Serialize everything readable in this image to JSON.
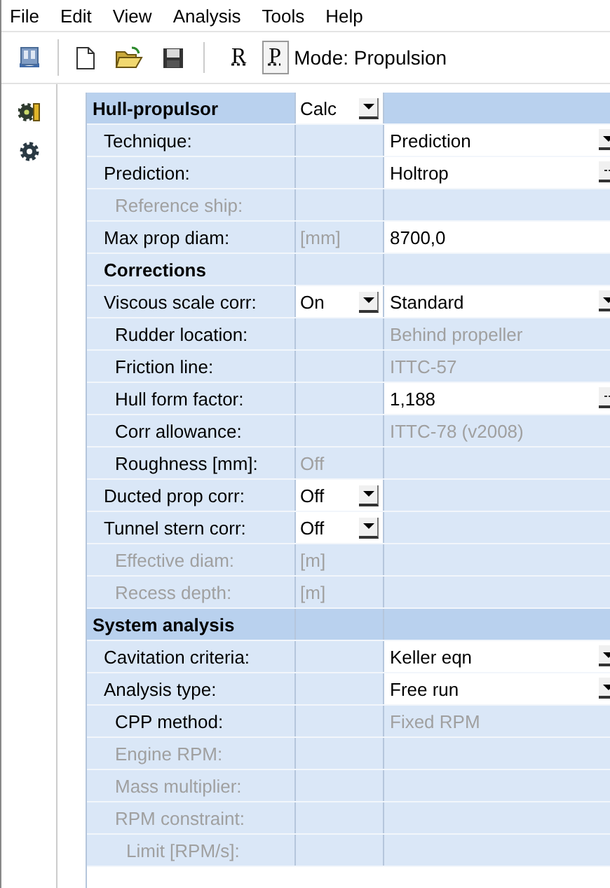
{
  "menu": [
    {
      "label": "File"
    },
    {
      "label": "Edit"
    },
    {
      "label": "View"
    },
    {
      "label": "Analysis"
    },
    {
      "label": "Tools"
    },
    {
      "label": "Help"
    }
  ],
  "toolbar": {
    "items": [
      {
        "kind": "new"
      },
      {
        "kind": "open"
      },
      {
        "kind": "save"
      },
      {
        "kind": "separator"
      },
      {
        "kind": "letter",
        "label": "R",
        "pressed": false
      },
      {
        "kind": "letter",
        "label": "P",
        "pressed": true
      }
    ],
    "mode": "Mode: Propulsion"
  },
  "side_tools": [
    {
      "kind": "gears"
    },
    {
      "kind": "gear"
    }
  ],
  "grid": {
    "rows": [
      {
        "kind": "section",
        "label": "Hull-propulsor",
        "option": {
          "value": "Calc"
        },
        "children": [
          {
            "kind": "param",
            "label": "Technique:",
            "disabled": false,
            "value": {
              "text": "Prediction",
              "disabled": false,
              "kind": "dropdown"
            }
          },
          {
            "kind": "param",
            "label": "Prediction:",
            "disabled": false,
            "value": {
              "text": "Holtrop",
              "disabled": false,
              "kind": "browse"
            },
            "children": [
              {
                "kind": "param",
                "label": "Reference ship:",
                "disabled": true
              }
            ]
          },
          {
            "kind": "param",
            "label": "Max prop diam:",
            "disabled": false,
            "unit": "[mm]",
            "value": {
              "text": "8700,0",
              "disabled": false,
              "kind": "text"
            }
          },
          {
            "kind": "heading",
            "label": "Corrections"
          },
          {
            "kind": "param",
            "label": "Viscous scale corr:",
            "disabled": false,
            "option": {
              "value": "On"
            },
            "value": {
              "text": "Standard",
              "disabled": false,
              "kind": "dropdown"
            },
            "children": [
              {
                "kind": "param",
                "label": "Rudder location:",
                "disabled": false,
                "value": {
                  "text": "Behind propeller",
                  "disabled": true
                }
              },
              {
                "kind": "param",
                "label": "Friction line:",
                "disabled": false,
                "value": {
                  "text": "ITTC-57",
                  "disabled": true
                }
              },
              {
                "kind": "param",
                "label": "Hull form factor:",
                "disabled": false,
                "value": {
                  "text": "1,188",
                  "disabled": false,
                  "kind": "browse"
                }
              },
              {
                "kind": "param",
                "label": "Corr allowance:",
                "disabled": false,
                "value": {
                  "text": "ITTC-78 (v2008)",
                  "disabled": true
                }
              },
              {
                "kind": "param",
                "label": "Roughness [mm]:",
                "disabled": false,
                "unit": "Off"
              }
            ]
          },
          {
            "kind": "param",
            "label": "Ducted prop corr:",
            "disabled": false,
            "option": {
              "value": "Off"
            }
          },
          {
            "kind": "param",
            "label": "Tunnel stern corr:",
            "disabled": false,
            "option": {
              "value": "Off"
            },
            "children": [
              {
                "kind": "param",
                "label": "Effective diam:",
                "disabled": true,
                "unit": "[m]"
              },
              {
                "kind": "param",
                "label": "Recess depth:",
                "disabled": true,
                "unit": "[m]"
              }
            ]
          }
        ]
      },
      {
        "kind": "section",
        "label": "System analysis",
        "children": [
          {
            "kind": "param",
            "label": "Cavitation criteria:",
            "disabled": false,
            "value": {
              "text": "Keller eqn",
              "disabled": false,
              "kind": "dropdown"
            }
          },
          {
            "kind": "param",
            "label": "Analysis type:",
            "disabled": false,
            "value": {
              "text": "Free run",
              "disabled": false,
              "kind": "dropdown"
            },
            "children": [
              {
                "kind": "param",
                "label": "CPP method:",
                "disabled": false,
                "value": {
                  "text": "Fixed RPM",
                  "disabled": true
                }
              },
              {
                "kind": "param",
                "label": "Engine RPM:",
                "disabled": true
              },
              {
                "kind": "param",
                "label": "Mass multiplier:",
                "disabled": true
              },
              {
                "kind": "param",
                "label": "RPM constraint:",
                "disabled": true,
                "children": [
                  {
                    "kind": "param",
                    "label": "Limit [RPM/s]:",
                    "disabled": true
                  }
                ]
              }
            ]
          }
        ]
      }
    ]
  }
}
